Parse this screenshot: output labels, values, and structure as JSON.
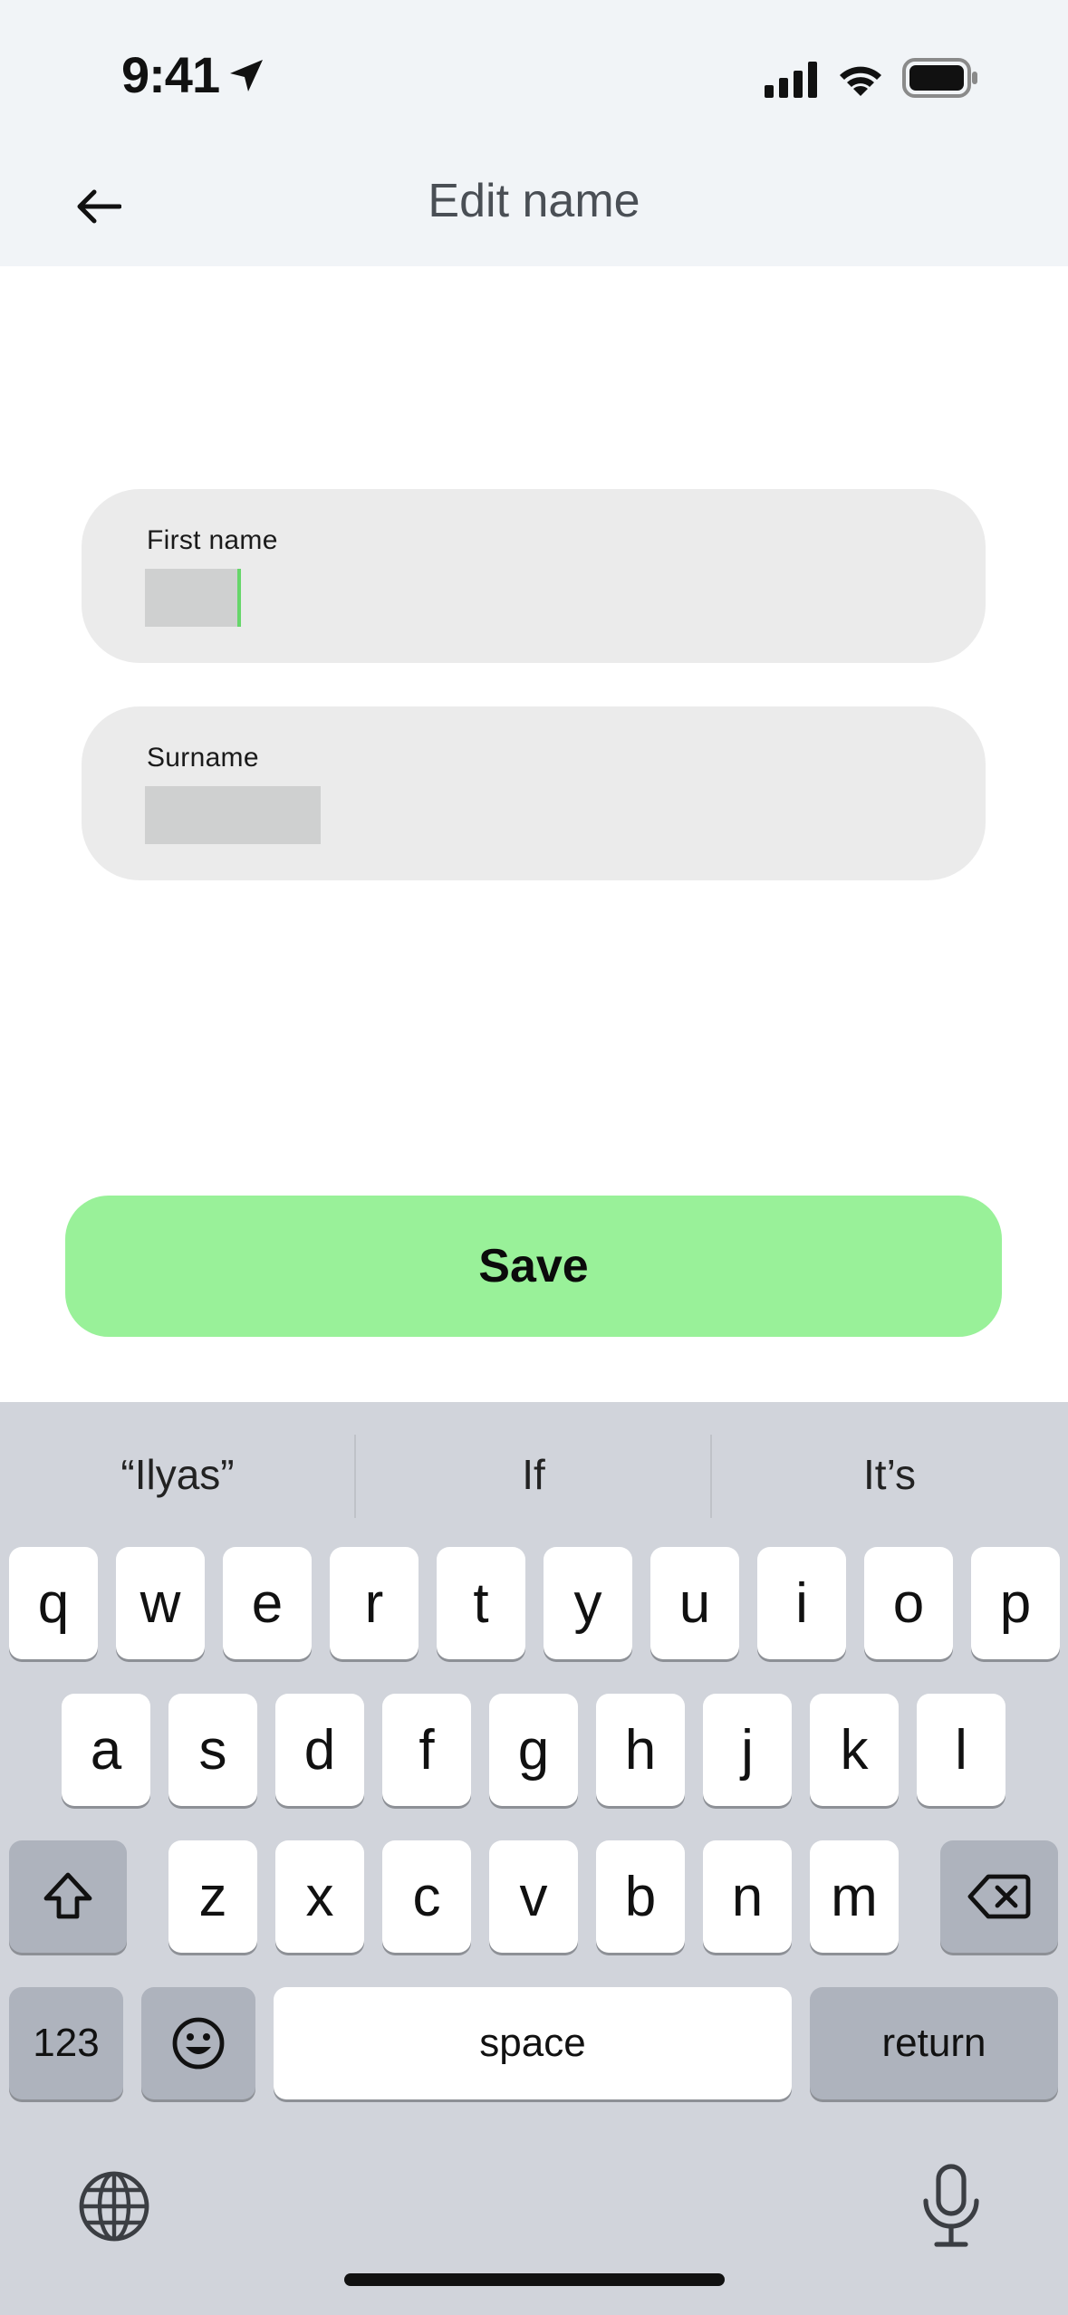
{
  "status_bar": {
    "time": "9:41",
    "icons": [
      "location-arrow-icon",
      "cellular-signal-icon",
      "wifi-icon",
      "battery-icon"
    ]
  },
  "header": {
    "back_icon": "arrow-left-icon",
    "title": "Edit name"
  },
  "form": {
    "first_name": {
      "label": "First name"
    },
    "surname": {
      "label": "Surname"
    },
    "caret_color": "#66d66a"
  },
  "actions": {
    "save_label": "Save",
    "save_color": "#99f199"
  },
  "keyboard": {
    "suggestions": [
      "“Ilyas”",
      "If",
      "It’s"
    ],
    "row1": [
      "q",
      "w",
      "e",
      "r",
      "t",
      "y",
      "u",
      "i",
      "o",
      "p"
    ],
    "row2": [
      "a",
      "s",
      "d",
      "f",
      "g",
      "h",
      "j",
      "k",
      "l"
    ],
    "row3": [
      "z",
      "x",
      "c",
      "v",
      "b",
      "n",
      "m"
    ],
    "numbers_label": "123",
    "space_label": "space",
    "return_label": "return",
    "icons": [
      "shift-icon",
      "delete-icon",
      "emoji-icon",
      "globe-icon",
      "microphone-icon"
    ]
  }
}
